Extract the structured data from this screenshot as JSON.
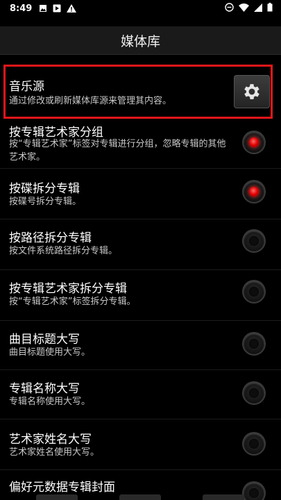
{
  "status_bar": {
    "time": "8:49"
  },
  "header": {
    "title": "媒体库"
  },
  "music_source": {
    "title": "音乐源",
    "subtitle": "通过修改或刷新媒体库源来管理其内容。"
  },
  "options": [
    {
      "title": "按专辑艺术家分组",
      "subtitle": "按“专辑艺术家”标签对专辑进行分组，忽略专辑的其他艺术家。",
      "checked": true
    },
    {
      "title": "按碟拆分专辑",
      "subtitle": "按碟号拆分专辑。",
      "checked": true
    },
    {
      "title": "按路径拆分专辑",
      "subtitle": "按文件系统路径拆分专辑。",
      "checked": false
    },
    {
      "title": "按专辑艺术家拆分专辑",
      "subtitle": "按“专辑艺术家”标签拆分专辑。",
      "checked": false
    },
    {
      "title": "曲目标题大写",
      "subtitle": "曲目标题使用大写。",
      "checked": false
    },
    {
      "title": "专辑名称大写",
      "subtitle": "专辑名称使用大写。",
      "checked": false
    },
    {
      "title": "艺术家姓名大写",
      "subtitle": "艺术家姓名使用大写。",
      "checked": false
    },
    {
      "title": "偏好元数据专辑封面",
      "subtitle": "",
      "checked": false
    }
  ],
  "colors": {
    "highlight": "#e8161a",
    "radio_on": "#e00000"
  }
}
